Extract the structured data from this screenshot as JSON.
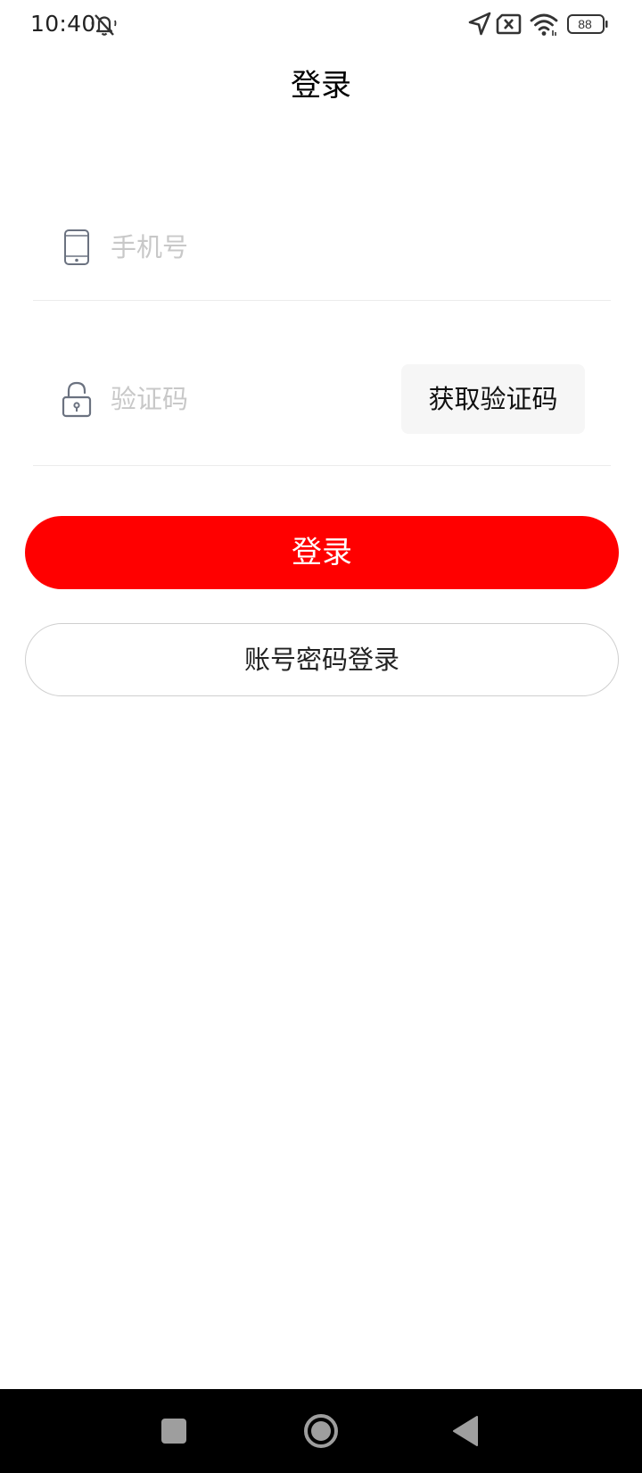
{
  "status_bar": {
    "time": "10:40",
    "icons": [
      "mute-icon",
      "location-icon",
      "no-sim-icon",
      "wifi-icon",
      "battery-icon"
    ],
    "battery_level": "88"
  },
  "header": {
    "title": "登录"
  },
  "form": {
    "phone": {
      "icon": "phone-icon",
      "value": "",
      "placeholder": "手机号"
    },
    "code": {
      "icon": "lock-icon",
      "value": "",
      "placeholder": "验证码",
      "get_code_label": "获取验证码"
    }
  },
  "actions": {
    "login_label": "登录",
    "password_login_label": "账号密码登录"
  },
  "nav_bar": {
    "icons": [
      "recents-icon",
      "home-icon",
      "back-icon"
    ]
  },
  "colors": {
    "primary": "#ff0000",
    "divider": "#ececec",
    "placeholder": "#c8c8c8",
    "code_button_bg": "#f6f6f6"
  }
}
